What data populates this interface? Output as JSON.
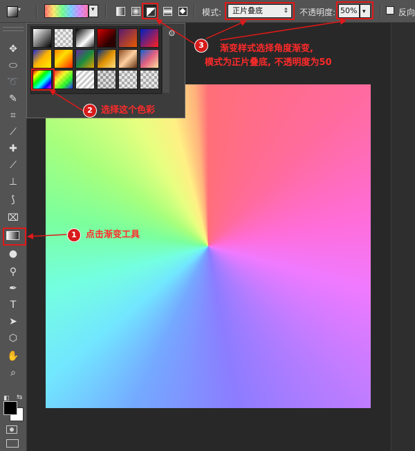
{
  "options_bar": {
    "mode_label": "模式:",
    "mode_value": "正片叠底",
    "opacity_label": "不透明度:",
    "opacity_value": "50%",
    "reverse_label": "反向"
  },
  "tools": [
    "move-tool",
    "marquee-tool",
    "lasso-tool",
    "quick-select-tool",
    "crop-tool",
    "eyedropper-tool",
    "healing-tool",
    "brush-tool",
    "stamp-tool",
    "history-brush-tool",
    "eraser-tool",
    "gradient-tool",
    "blur-tool",
    "dodge-tool",
    "pen-tool",
    "type-tool",
    "path-select-tool",
    "shape-tool",
    "hand-tool",
    "zoom-tool"
  ],
  "annotations": {
    "step1_number": "1",
    "step1_text": "点击渐变工具",
    "step2_number": "2",
    "step2_text": "选择这个色彩",
    "step3_number": "3",
    "step3_line1": "渐变样式选择角度渐变,",
    "step3_line2": "模式为正片叠底, 不透明度为50"
  },
  "colors": {
    "annotation_red": "#e11919",
    "ui_dark": "#535353"
  }
}
